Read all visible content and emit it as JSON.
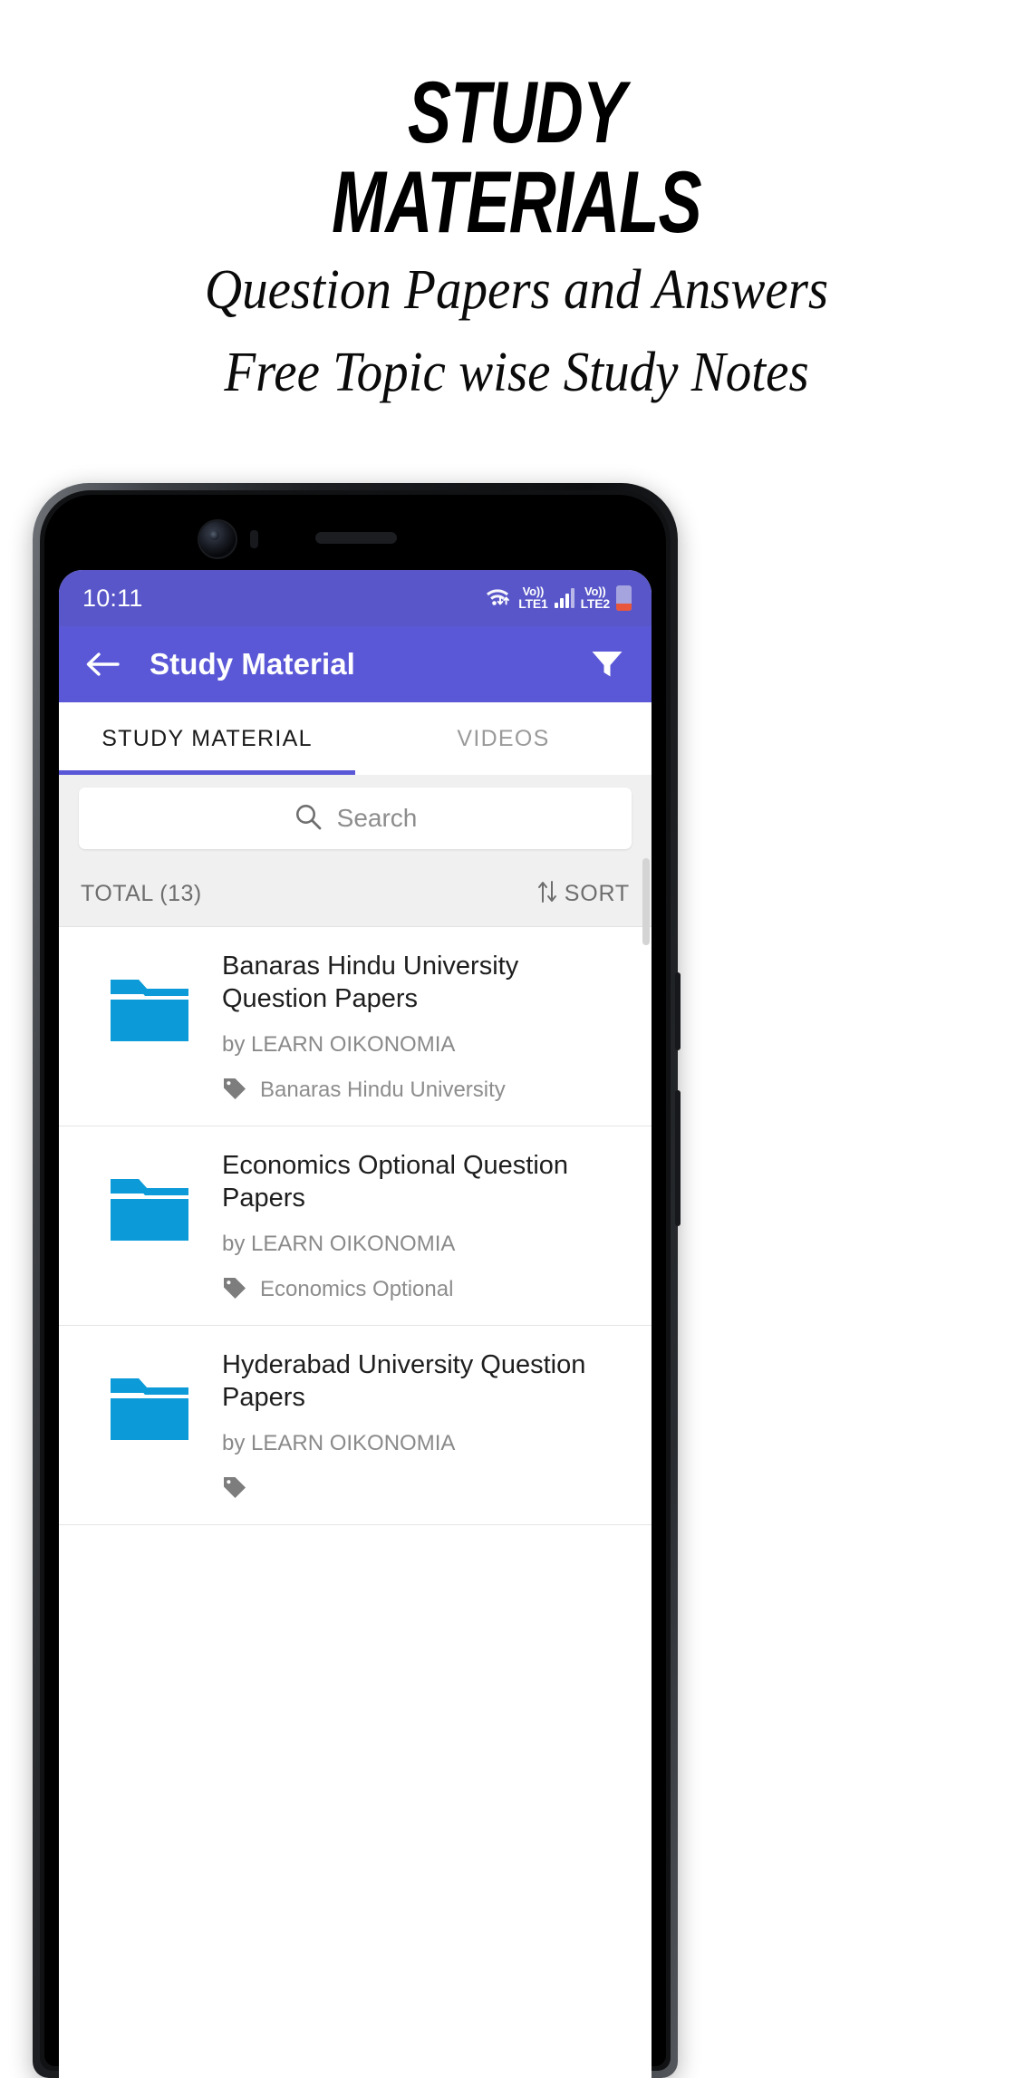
{
  "hero": {
    "title_line1": "STUDY",
    "title_line2": "MATERIALS",
    "subtitle_line1": "Question Papers and Answers",
    "subtitle_line2": "Free Topic wise Study Notes"
  },
  "colors": {
    "status_bar": "#5856C8",
    "app_bar": "#5A58D6",
    "tab_indicator": "#5A58D6",
    "folder_icon": "#0C9BD8",
    "battery_low": "#e8563c",
    "list_bg": "#ffffff",
    "chrome_bg": "#f0f0f0"
  },
  "statusbar": {
    "time": "10:11",
    "wifi_icon": "wifi-icon",
    "sim1_label_top": "Vo))",
    "sim1_label_bottom": "LTE1",
    "sim2_label_top": "Vo))",
    "sim2_label_bottom": "LTE2",
    "signal_icon": "signal-bars-icon",
    "battery_icon": "battery-low-icon"
  },
  "appbar": {
    "back_icon": "back-arrow-icon",
    "title": "Study Material",
    "filter_icon": "filter-icon"
  },
  "tabs": [
    {
      "label": "STUDY MATERIAL",
      "active": true
    },
    {
      "label": "VIDEOS",
      "active": false
    }
  ],
  "search": {
    "icon": "search-icon",
    "placeholder": "Search",
    "value": ""
  },
  "toolbar": {
    "total_label": "TOTAL (13)",
    "sort_label": "SORT",
    "sort_icon": "sort-arrows-icon"
  },
  "list": {
    "items": [
      {
        "icon": "folder-icon",
        "title": "Banaras Hindu University Question Papers",
        "author": "by LEARN OIKONOMIA",
        "tag_icon": "tag-icon",
        "tag": "Banaras Hindu University"
      },
      {
        "icon": "folder-icon",
        "title": "Economics Optional Question Papers",
        "author": "by LEARN OIKONOMIA",
        "tag_icon": "tag-icon",
        "tag": "Economics Optional"
      },
      {
        "icon": "folder-icon",
        "title": "Hyderabad University Question Papers",
        "author": "by LEARN OIKONOMIA",
        "tag_icon": "tag-icon",
        "tag": ""
      }
    ]
  }
}
